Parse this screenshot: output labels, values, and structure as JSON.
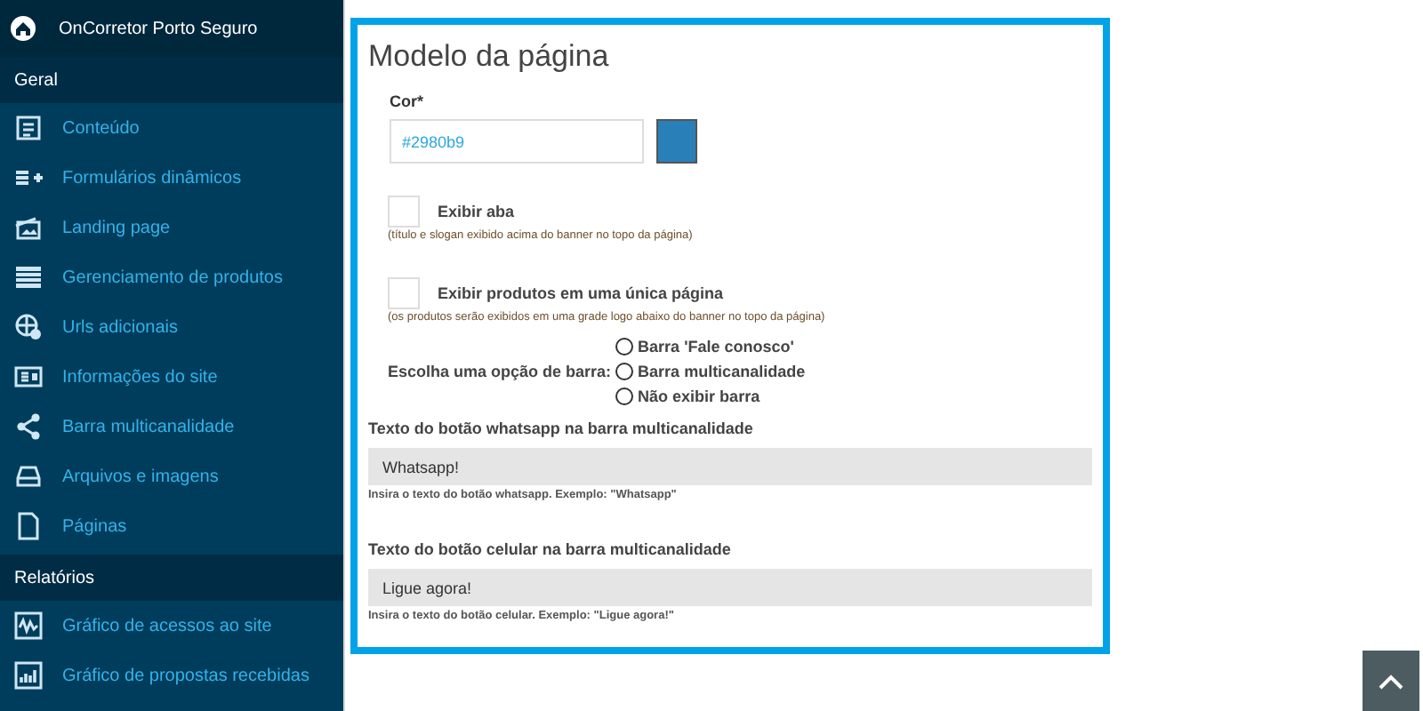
{
  "sidebar": {
    "brand": "OnCorretor Porto Seguro",
    "sections": [
      {
        "title": "Geral",
        "items": [
          {
            "label": "Conteúdo",
            "kind": "document"
          },
          {
            "label": "Formulários dinâmicos",
            "kind": "form"
          },
          {
            "label": "Landing page",
            "kind": "landing"
          },
          {
            "label": "Gerenciamento de produtos",
            "kind": "products"
          },
          {
            "label": "Urls adicionais",
            "kind": "urls"
          },
          {
            "label": "Informações do site",
            "kind": "info"
          },
          {
            "label": "Barra multicanalidade",
            "kind": "share"
          },
          {
            "label": "Arquivos e imagens",
            "kind": "files"
          },
          {
            "label": "Páginas",
            "kind": "page"
          }
        ]
      },
      {
        "title": "Relatórios",
        "items": [
          {
            "label": "Gráfico de acessos ao site",
            "kind": "access-chart"
          },
          {
            "label": "Gráfico de propostas recebidas",
            "kind": "proposal-chart"
          }
        ]
      }
    ]
  },
  "form": {
    "title": "Modelo da página",
    "color_field": {
      "label": "Cor*",
      "value": "#2980b9"
    },
    "checkboxes": [
      {
        "label": "Exibir aba",
        "checked": false,
        "hint": "(título e slogan exibido acima do banner no topo da página)"
      },
      {
        "label": "Exibir produtos em uma única página",
        "checked": false,
        "hint": "(os produtos serão exibidos em uma grade logo abaixo do banner no topo da página)"
      }
    ],
    "bar_choice": {
      "label": "Escolha uma opção de barra:",
      "options": [
        {
          "label": "Barra 'Fale conosco'",
          "selected": false
        },
        {
          "label": "Barra multicanalidade",
          "selected": false
        },
        {
          "label": "Não exibir barra",
          "selected": false
        }
      ]
    },
    "text_fields": [
      {
        "label": "Texto do botão whatsapp na barra multicanalidade",
        "value": "Whatsapp!",
        "hint": "Insira o texto do botão whatsapp. Exemplo: \"Whatsapp\""
      },
      {
        "label": "Texto do botão celular na barra multicanalidade",
        "value": "Ligue agora!",
        "hint": "Insira o texto do botão celular. Exemplo: \"Ligue agora!\""
      }
    ]
  }
}
